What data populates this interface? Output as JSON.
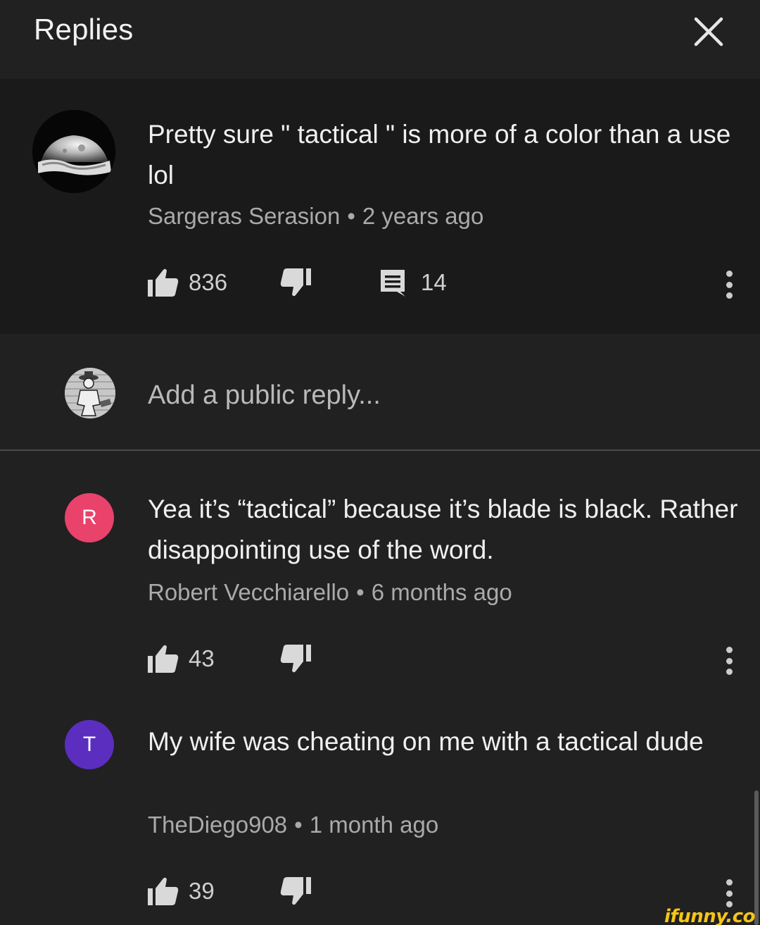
{
  "header": {
    "title": "Replies",
    "close_icon": "close-icon"
  },
  "parent_comment": {
    "text": "Pretty sure \" tactical \" is more of a color than a use lol",
    "author": "Sargeras Serasion",
    "separator": "•",
    "time": "2 years ago",
    "likes": "836",
    "replies": "14",
    "avatar": "moon-avatar"
  },
  "reply_box": {
    "placeholder": "Add a public reply..."
  },
  "replies": [
    {
      "avatar_letter": "R",
      "avatar_color": "#e9426b",
      "text": "Yea it’s “tactical” because it’s blade is black. Rather disappointing use of the word.",
      "author": "Robert Vecchiarello",
      "separator": "•",
      "time": "6 months ago",
      "likes": "43"
    },
    {
      "avatar_letter": "T",
      "avatar_color": "#5b2ec0",
      "text": "My wife was cheating on me with a tactical dude",
      "author": "TheDiego908",
      "separator": "•",
      "time": "1 month ago",
      "likes": "39"
    }
  ],
  "watermark": "ifunny.co",
  "colors": {
    "background": "#212121",
    "parent_background": "#1a1a1a",
    "text": "#f0f0f0",
    "meta": "#aaaaaa",
    "watermark": "#f5c518"
  }
}
